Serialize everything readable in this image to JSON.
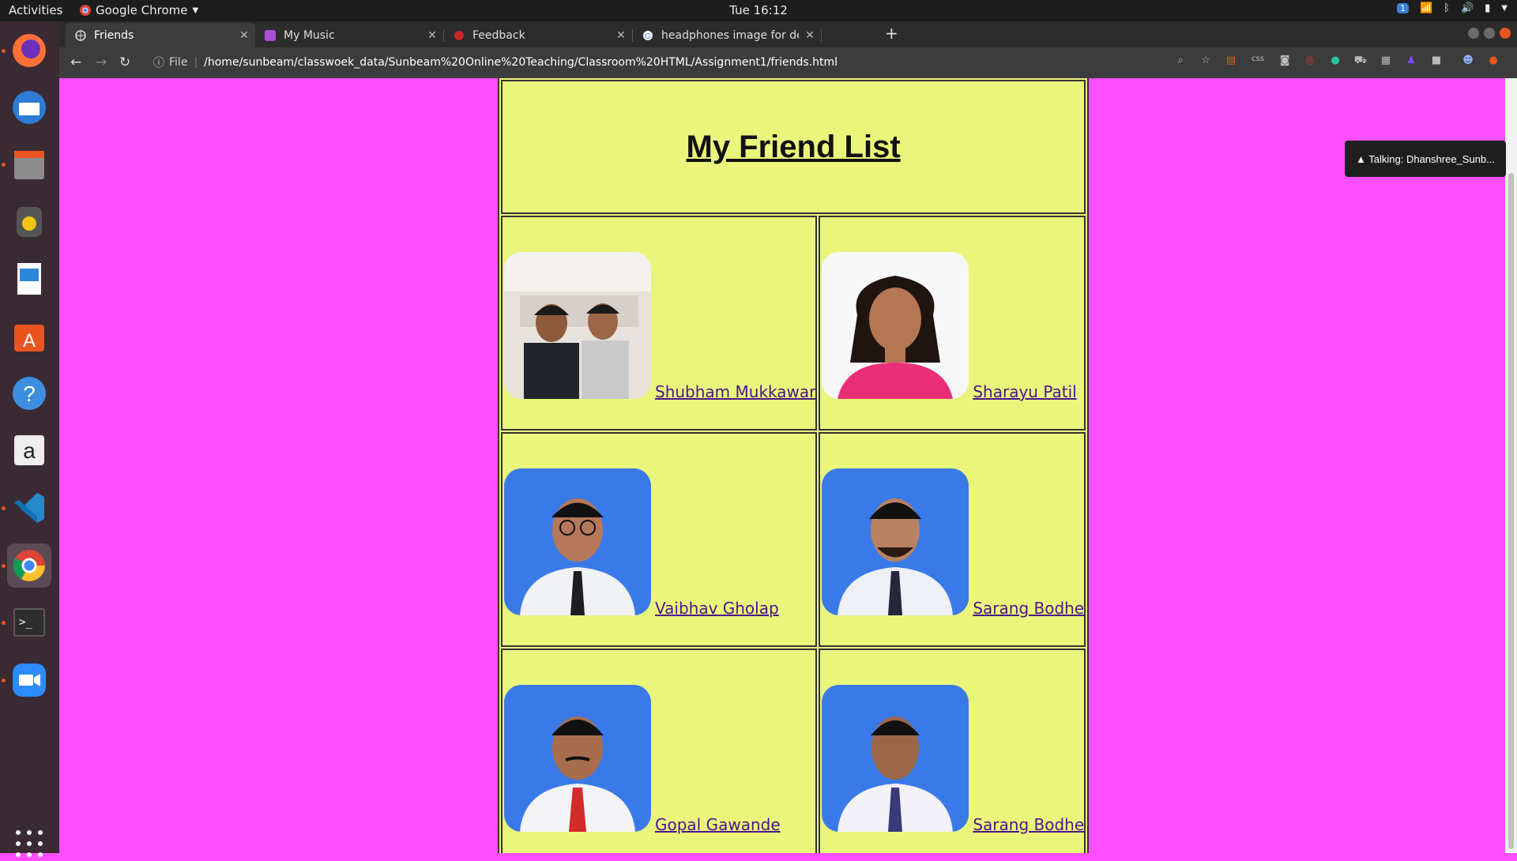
{
  "topbar": {
    "activities": "Activities",
    "app_name": "Google Chrome",
    "clock": "Tue 16:12",
    "notification_count": "1"
  },
  "tabs": [
    {
      "label": "Friends",
      "active": true
    },
    {
      "label": "My Music",
      "active": false
    },
    {
      "label": "Feedback",
      "active": false
    },
    {
      "label": "headphones image for de",
      "active": false
    }
  ],
  "toolbar": {
    "scheme": "File",
    "url": "/home/sunbeam/classwoek_data/Sunbeam%20Online%20Teaching/Classroom%20HTML/Assignment1/friends.html",
    "extensions": [
      "zoom-icon",
      "star-icon",
      "bookmark-ext-icon",
      "css-ext-icon",
      "camera-ext-icon",
      "ghostery-ext-icon",
      "mendeley-ext-icon",
      "cart-ext-icon",
      "window-ext-icon",
      "users-ext-icon",
      "dark-ext-icon",
      "profile-icon",
      "update-icon"
    ],
    "css_ext_label": "css"
  },
  "dock": [
    "firefox",
    "thunderbird",
    "files",
    "rhythmbox",
    "libreoffice-writer",
    "ubuntu-software",
    "help",
    "amazon",
    "vscode",
    "chrome",
    "terminal",
    "zoom"
  ],
  "page": {
    "title": "My Friend List",
    "friends": [
      {
        "name": "Shubham Mukkawar",
        "photo": "selfie-two-friends"
      },
      {
        "name": "Sharayu Patil",
        "photo": "portrait-woman-pink-bg"
      },
      {
        "name": "Vaibhav Gholap",
        "photo": "portrait-man-blue-bg"
      },
      {
        "name": "Sarang Bodhe",
        "photo": "portrait-man-blue-bg"
      },
      {
        "name": "Gopal Gawande",
        "photo": "portrait-man-blue-bg"
      },
      {
        "name": "Sarang Bodhe",
        "photo": "portrait-man-blue-bg"
      }
    ]
  },
  "overlay": {
    "talking": "▲ Talking: Dhanshree_Sunb..."
  },
  "colors": {
    "page_bg": "#ff4fff",
    "table_bg": "#eaf57c",
    "link": "#4a168a",
    "accent": "#e95420"
  }
}
